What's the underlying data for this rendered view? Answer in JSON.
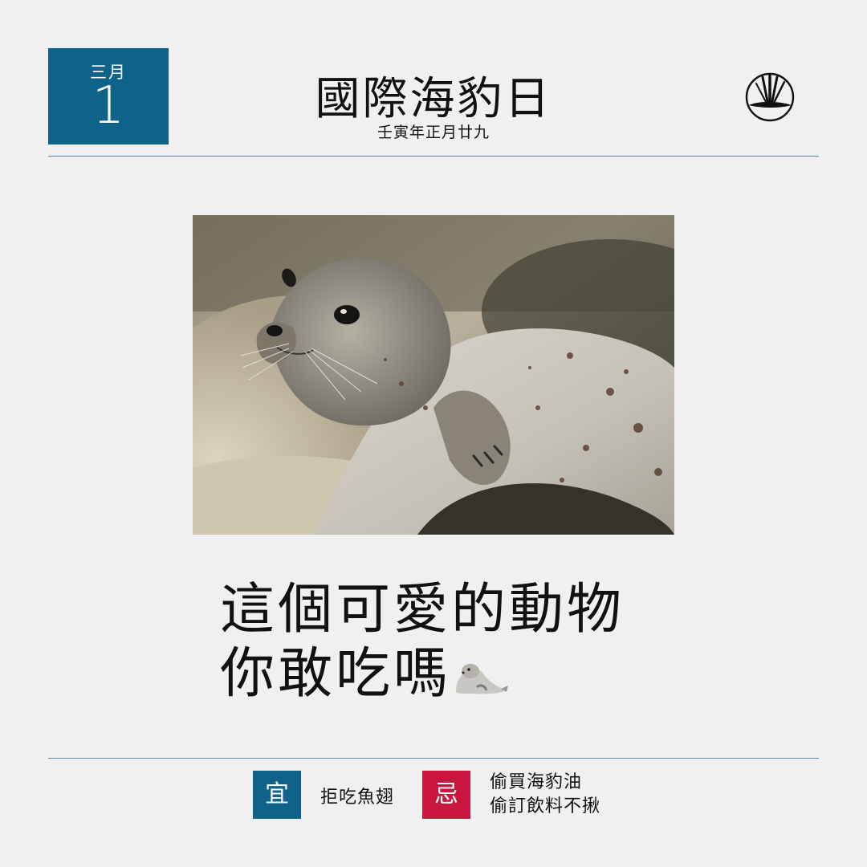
{
  "date": {
    "month": "三月",
    "day": "1"
  },
  "header": {
    "title": "國際海豹日",
    "lunar_date": "壬寅年正月廿九"
  },
  "logo": {
    "icon": "brush-strokes-logo-icon"
  },
  "photo": {
    "subject": "seal-photo"
  },
  "headline": {
    "line1": "這個可愛的動物",
    "line2": "你敢吃嗎",
    "emoji": "seal-icon"
  },
  "footer": {
    "good_label": "宜",
    "good_text": "拒吃魚翅",
    "bad_label": "忌",
    "bad_lines": [
      "偷買海豹油",
      "偷訂飲料不揪"
    ]
  },
  "colors": {
    "blue": "#0f6289",
    "red": "#c8163f",
    "background": "#f0f0f0"
  }
}
